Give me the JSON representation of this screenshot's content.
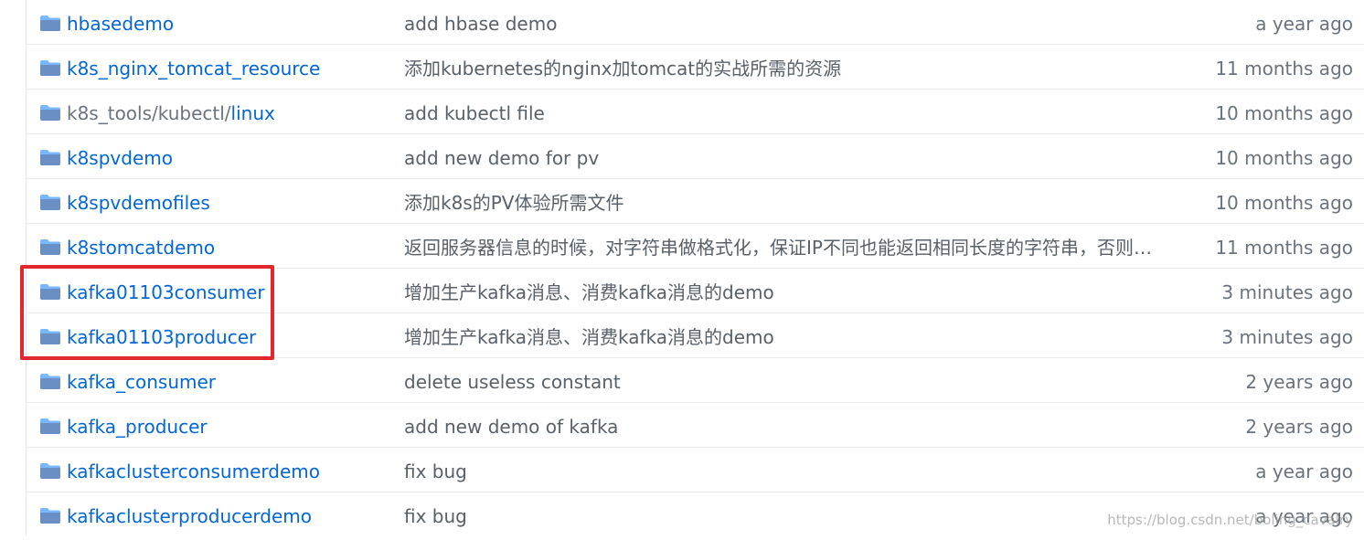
{
  "icon": "folder-icon",
  "accent_color": "#0366d6",
  "highlight_color": "#e3282d",
  "rows": [
    {
      "name": "hbasedemo",
      "name_prefix": "",
      "message": "add hbase demo",
      "age": "a year ago"
    },
    {
      "name": "k8s_nginx_tomcat_resource",
      "name_prefix": "",
      "message": "添加kubernetes的nginx加tomcat的实战所需的资源",
      "age": "11 months ago"
    },
    {
      "name": "linux",
      "name_prefix": "k8s_tools/kubectl/",
      "message": "add kubectl file",
      "age": "10 months ago"
    },
    {
      "name": "k8spvdemo",
      "name_prefix": "",
      "message": "add new demo for pv",
      "age": "10 months ago"
    },
    {
      "name": "k8spvdemofiles",
      "name_prefix": "",
      "message": "添加k8s的PV体验所需文件",
      "age": "10 months ago"
    },
    {
      "name": "k8stomcatdemo",
      "name_prefix": "",
      "message": "返回服务器信息的时候，对字符串做格式化，保证IP不同也能返回相同长度的字符串，否则…",
      "age": "11 months ago"
    },
    {
      "name": "kafka01103consumer",
      "name_prefix": "",
      "message": "增加生产kafka消息、消费kafka消息的demo",
      "age": "3 minutes ago"
    },
    {
      "name": "kafka01103producer",
      "name_prefix": "",
      "message": "增加生产kafka消息、消费kafka消息的demo",
      "age": "3 minutes ago"
    },
    {
      "name": "kafka_consumer",
      "name_prefix": "",
      "message": "delete useless constant",
      "age": "2 years ago"
    },
    {
      "name": "kafka_producer",
      "name_prefix": "",
      "message": "add new demo of kafka",
      "age": "2 years ago"
    },
    {
      "name": "kafkaclusterconsumerdemo",
      "name_prefix": "",
      "message": "fix bug",
      "age": "a year ago"
    },
    {
      "name": "kafkaclusterproducerdemo",
      "name_prefix": "",
      "message": "fix bug",
      "age": "a year ago"
    }
  ],
  "watermark": "https://blog.csdn.net/boling_cavalry"
}
